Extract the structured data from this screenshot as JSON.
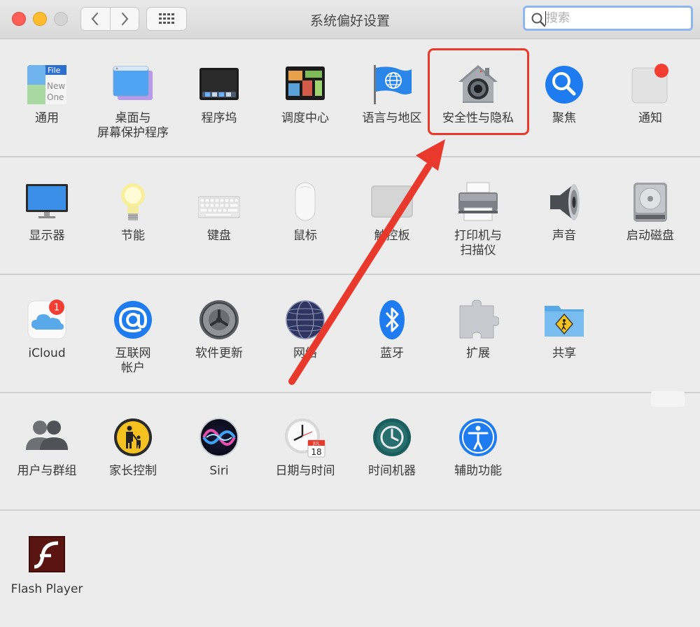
{
  "window": {
    "title": "系统偏好设置"
  },
  "search": {
    "placeholder": "搜索"
  },
  "rows": [
    [
      "通用",
      "桌面与\n屏幕保护程序",
      "程序坞",
      "调度中心",
      "语言与地区",
      "安全性与隐私",
      "聚焦",
      "通知"
    ],
    [
      "显示器",
      "节能",
      "键盘",
      "鼠标",
      "触控板",
      "打印机与\n扫描仪",
      "声音",
      "启动磁盘"
    ],
    [
      "iCloud",
      "互联网\n帐户",
      "软件更新",
      "网络",
      "蓝牙",
      "扩展",
      "共享"
    ],
    [
      "用户与群组",
      "家长控制",
      "Siri",
      "日期与时间",
      "时间机器",
      "辅助功能"
    ],
    [
      "Flash Player"
    ]
  ],
  "icons": {
    "general_file": "File",
    "general_new": "New",
    "general_one": "One",
    "icloud_badge": "1",
    "calendar_month": "JUL",
    "calendar_day": "18"
  },
  "colors": {
    "highlight": "#e8392c",
    "accent": "#1e7bf0",
    "notification": "#f23d33"
  }
}
